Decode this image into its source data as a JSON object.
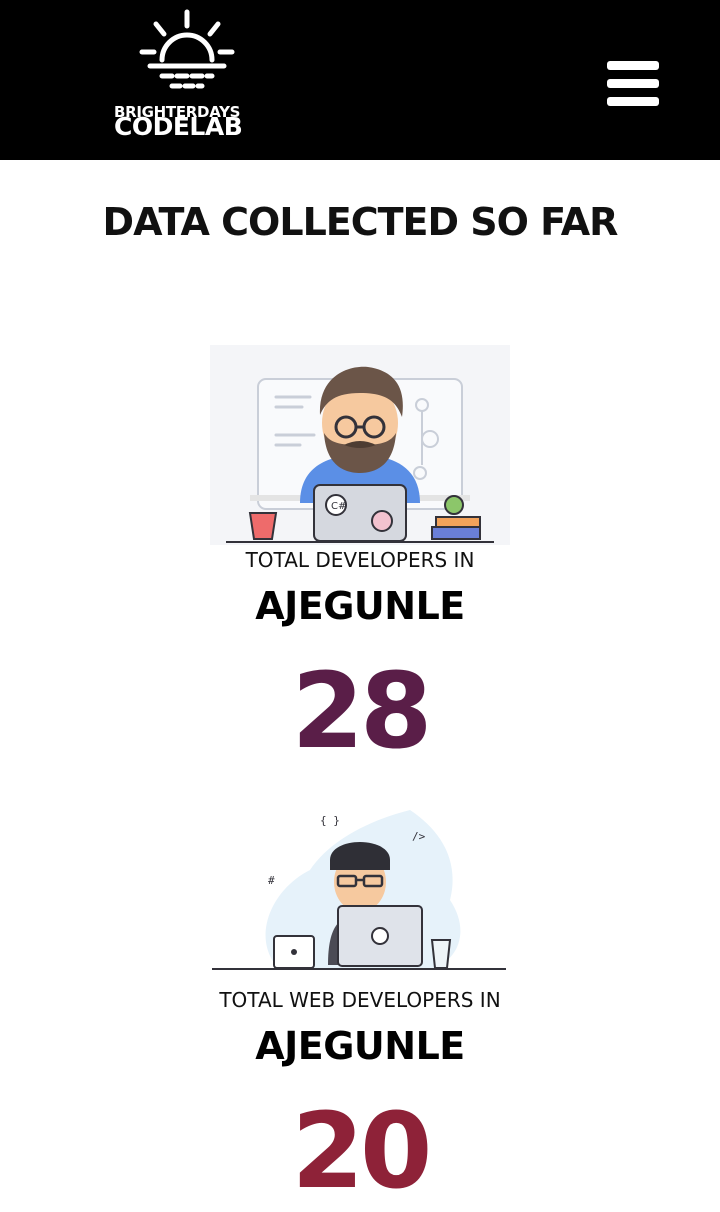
{
  "header": {
    "logo_line1": "BRIGHTERDAYS",
    "logo_line2": "CODELAB",
    "menu_icon": "hamburger-icon"
  },
  "page": {
    "title": "DATA COLLECTED SO FAR"
  },
  "stats": [
    {
      "caption": "TOTAL DEVELOPERS IN",
      "place": "AJEGUNLE",
      "count": "28",
      "color": "#5a1e48",
      "illustration": "bearded-developer-illustration"
    },
    {
      "caption": "TOTAL WEB DEVELOPERS IN",
      "place": "AJEGUNLE",
      "count": "20",
      "color": "#8e2238",
      "illustration": "web-developer-illustration"
    }
  ]
}
